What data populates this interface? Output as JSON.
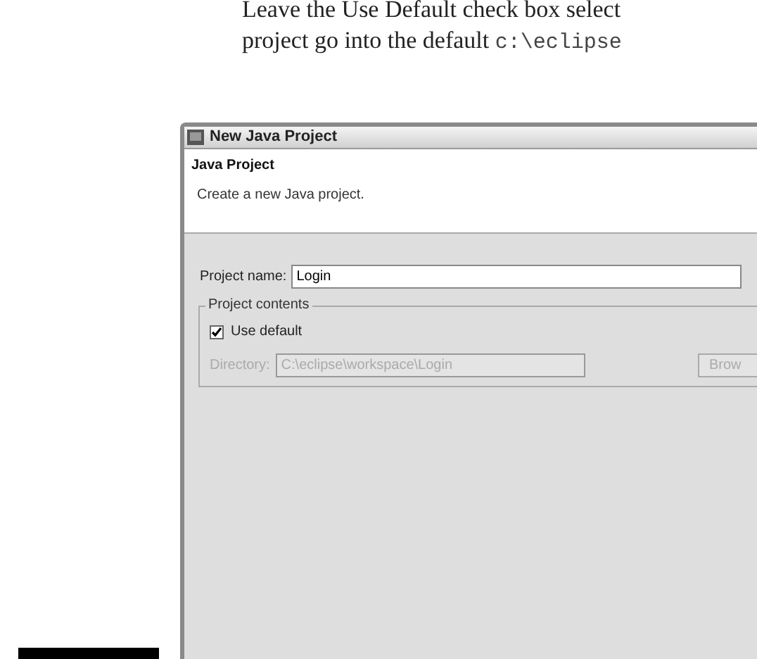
{
  "book_text": {
    "line_1": "Leave the Use Default check box select",
    "line_2": {
      "text": "project go into the default ",
      "code": "c:\\eclipse"
    }
  },
  "window": {
    "title": "New Java Project"
  },
  "header": {
    "title": "Java Project",
    "description": "Create a new Java project."
  },
  "project_name": {
    "label": "Project name:",
    "value": "Login"
  },
  "project_contents": {
    "label": "Project contents",
    "use_default": {
      "label": "Use default",
      "checked": true
    },
    "directory": {
      "label": "Directory:",
      "value": "C:\\eclipse\\workspace\\Login",
      "disabled": true
    },
    "browse_button": {
      "label": "Brow",
      "disabled": true
    }
  }
}
